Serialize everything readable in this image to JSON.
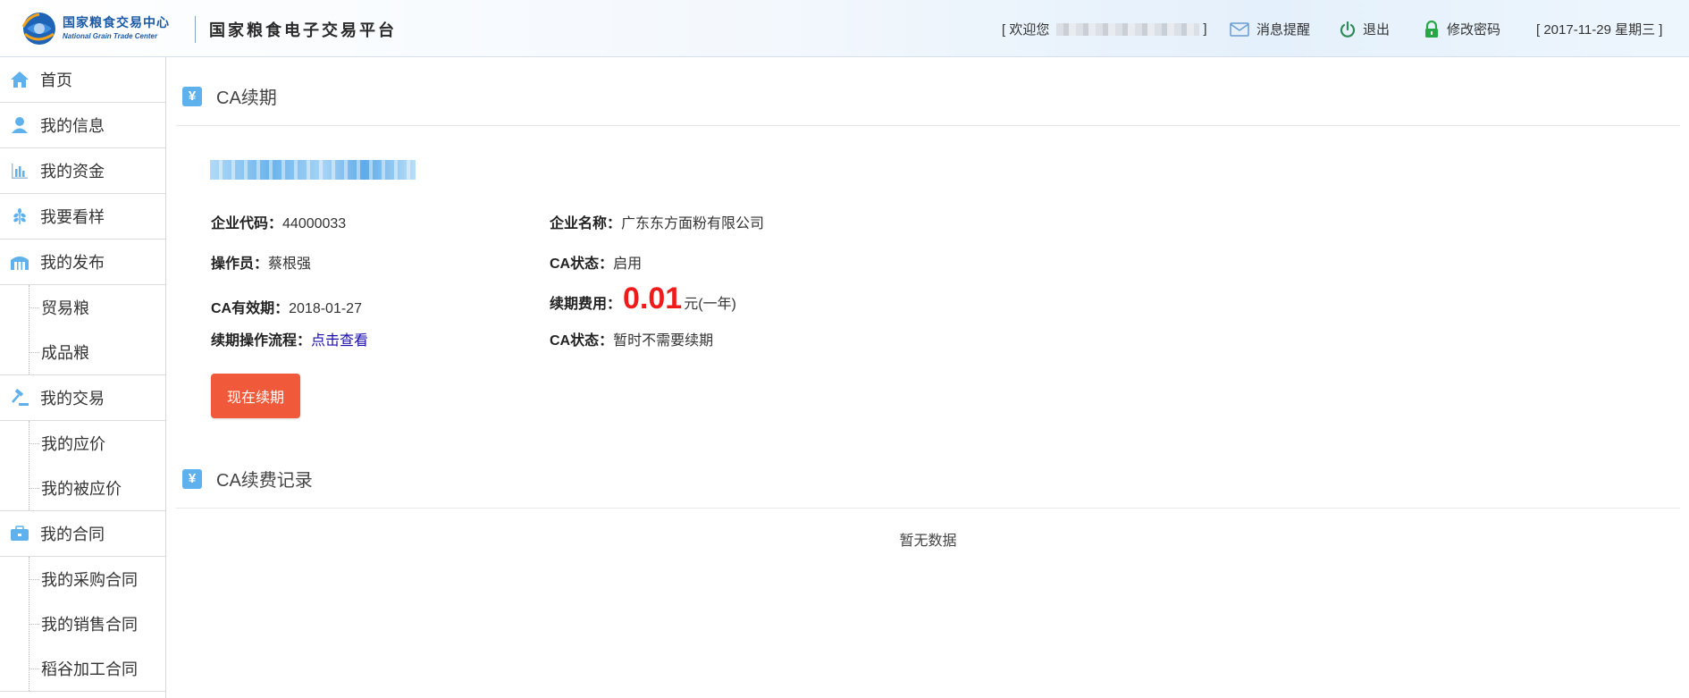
{
  "header": {
    "logo_cn": "国家粮食交易中心",
    "logo_en": "National Grain Trade Center",
    "platform_title": "国家粮食电子交易平台",
    "welcome_prefix": "[ 欢迎您",
    "welcome_suffix": "]",
    "message_label": "消息提醒",
    "logout_label": "退出",
    "change_password_label": "修改密码",
    "date_label": "[ 2017-11-29 星期三 ]"
  },
  "sidebar": {
    "items": [
      {
        "label": "首页",
        "icon": "home-icon"
      },
      {
        "label": "我的信息",
        "icon": "user-icon"
      },
      {
        "label": "我的资金",
        "icon": "bar-chart-icon"
      },
      {
        "label": "我要看样",
        "icon": "grain-icon"
      },
      {
        "label": "我的发布",
        "icon": "warehouse-icon",
        "children": [
          "贸易粮",
          "成品粮"
        ]
      },
      {
        "label": "我的交易",
        "icon": "gavel-icon",
        "children": [
          "我的应价",
          "我的被应价"
        ]
      },
      {
        "label": "我的合同",
        "icon": "briefcase-icon",
        "children": [
          "我的采购合同",
          "我的销售合同",
          "稻谷加工合同"
        ]
      }
    ]
  },
  "main": {
    "section1_title": "CA续期",
    "enterprise_code_label": "企业代码：",
    "enterprise_code_value": "44000033",
    "enterprise_name_label": "企业名称：",
    "enterprise_name_value": "广东东方面粉有限公司",
    "operator_label": "操作员：",
    "operator_value": "蔡根强",
    "ca_status_label": "CA状态：",
    "ca_status_value": "启用",
    "ca_expiry_label": "CA有效期：",
    "ca_expiry_value": "2018-01-27",
    "renew_fee_label": "续期费用：",
    "renew_fee_value": "0.01",
    "renew_fee_unit": "元(一年)",
    "renew_flow_label": "续期操作流程：",
    "renew_flow_link": "点击查看",
    "ca_status2_label": "CA状态：",
    "ca_status2_value": "暂时不需要续期",
    "renew_button": "现在续期",
    "section2_title": "CA续费记录",
    "empty_text": "暂无数据"
  },
  "colors": {
    "accent_blue": "#5fb1ee",
    "button_red": "#f05a3a",
    "fee_red": "#ef1b1b",
    "link_blue": "#1a0dab"
  }
}
